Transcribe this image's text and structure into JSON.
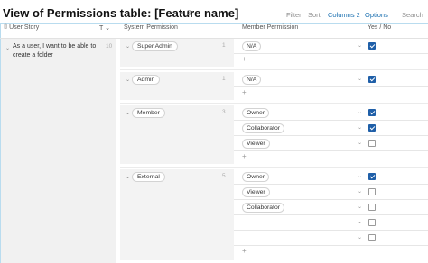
{
  "header": {
    "title": "View of Permissions table: [Feature name]",
    "link_count": "3",
    "toolbar": {
      "filter": "Filter",
      "sort": "Sort",
      "columns": "Columns",
      "columns_count": "2",
      "options": "Options",
      "search": "Search"
    }
  },
  "columns": {
    "user_story": "User Story",
    "system_permission": "System Permission",
    "member_permission": "Member Permission",
    "yes_no": "Yes / No"
  },
  "story": {
    "text": "As a user, I want to be able to create a folder",
    "number": "10"
  },
  "groups": [
    {
      "label": "Super Admin",
      "number": "1",
      "rows": [
        {
          "member": "N/A",
          "checked": true
        }
      ]
    },
    {
      "label": "Admin",
      "number": "1",
      "rows": [
        {
          "member": "N/A",
          "checked": true
        }
      ]
    },
    {
      "label": "Member",
      "number": "3",
      "rows": [
        {
          "member": "Owner",
          "checked": true
        },
        {
          "member": "Collaborator",
          "checked": true
        },
        {
          "member": "Viewer",
          "checked": false
        }
      ]
    },
    {
      "label": "External",
      "number": "5",
      "rows": [
        {
          "member": "Owner",
          "checked": true
        },
        {
          "member": "Viewer",
          "checked": false
        },
        {
          "member": "Collaborator",
          "checked": false
        },
        {
          "member": "",
          "checked": false
        },
        {
          "member": "",
          "checked": false
        }
      ]
    }
  ],
  "add_symbol": "+",
  "icons": {
    "link": "link-icon",
    "user_story_col": "bookmark-icon",
    "text_type": "text-type-icon",
    "chevron": "chevron-down-icon"
  },
  "colors": {
    "accent": "#1a6fb0",
    "checkbox": "#1f5fa8",
    "group_bg": "#f3f3f3"
  }
}
